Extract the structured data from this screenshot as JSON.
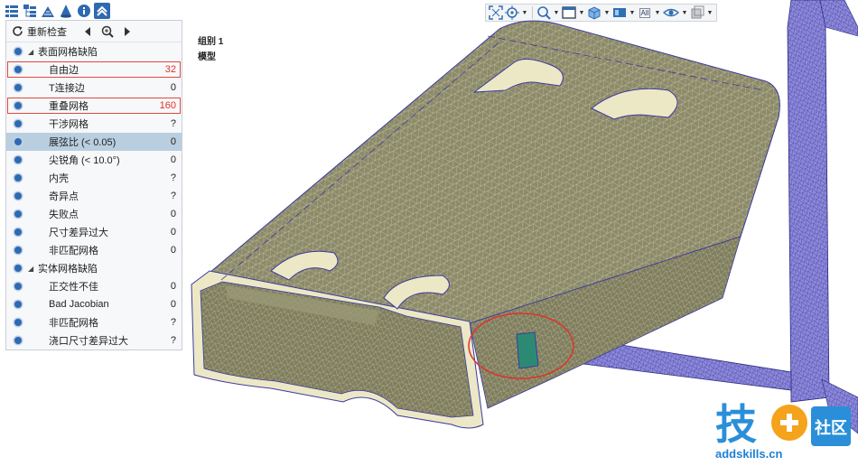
{
  "toolbar_icons": [
    "list-icon",
    "tree-icon",
    "mesh-icon",
    "cone-icon",
    "info-icon",
    "collapse-icon"
  ],
  "panel": {
    "recheck_label": "重新检查",
    "rows": [
      {
        "kind": "group",
        "label": "表面网格缺陷",
        "value": ""
      },
      {
        "kind": "item",
        "label": "自由边",
        "value": "32",
        "highlight": true,
        "red": true
      },
      {
        "kind": "item",
        "label": "T连接边",
        "value": "0"
      },
      {
        "kind": "item",
        "label": "重叠网格",
        "value": "160",
        "highlight": true,
        "red": true
      },
      {
        "kind": "item",
        "label": "干涉网格",
        "value": "?"
      },
      {
        "kind": "item",
        "label": "展弦比 (< 0.05)",
        "value": "0",
        "selected": true
      },
      {
        "kind": "item",
        "label": "尖锐角 (< 10.0°)",
        "value": "0"
      },
      {
        "kind": "item",
        "label": "内壳",
        "value": "?"
      },
      {
        "kind": "item",
        "label": "奇异点",
        "value": "?"
      },
      {
        "kind": "item",
        "label": "失败点",
        "value": "0"
      },
      {
        "kind": "item",
        "label": "尺寸差异过大",
        "value": "0"
      },
      {
        "kind": "item",
        "label": "非匹配网格",
        "value": "0"
      },
      {
        "kind": "group",
        "label": "实体网格缺陷",
        "value": ""
      },
      {
        "kind": "item",
        "label": "正交性不佳",
        "value": "0"
      },
      {
        "kind": "item",
        "label": "Bad Jacobian",
        "value": "0"
      },
      {
        "kind": "item",
        "label": "非匹配网格",
        "value": "?"
      },
      {
        "kind": "item",
        "label": "浇口尺寸差异过大",
        "value": "?"
      }
    ]
  },
  "view_toolbar": {
    "all_label": "All"
  },
  "model_labels": {
    "group": "组别 1",
    "model": "模型"
  },
  "watermark": {
    "brand": "技",
    "badge": "社区",
    "url": "addskills.cn"
  },
  "colors": {
    "accent": "#2f69b0",
    "red": "#e0322b",
    "selected_row": "#b9cfe0",
    "mesh_olive": "#8b8a6a",
    "mesh_edge": "#f0ecc8",
    "runner_purple": "#8c89d9"
  }
}
